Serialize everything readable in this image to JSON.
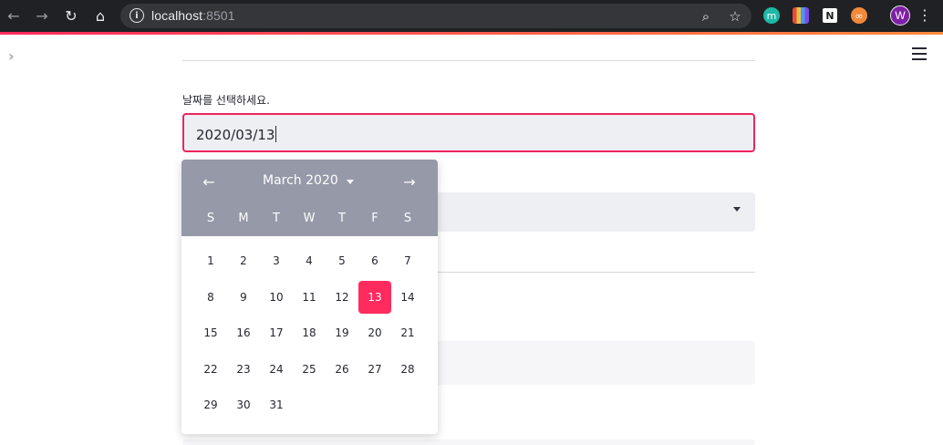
{
  "browser": {
    "url_host": "localhost",
    "url_port": ":8501",
    "profile_initial": "W",
    "extensions": [
      {
        "name": "m-extension-icon",
        "label": "m",
        "color": "#1fb8a6"
      },
      {
        "name": "palette-extension-icon",
        "label": "",
        "color": "#e9c341"
      },
      {
        "name": "notion-extension-icon",
        "label": "N",
        "color": "#ffffff"
      },
      {
        "name": "glasses-extension-icon",
        "label": "",
        "color": "#f08a3a"
      }
    ]
  },
  "page": {
    "date_label": "날짜를 선택하세요.",
    "date_value": "2020/03/13"
  },
  "calendar": {
    "month_label": "March 2020",
    "weekdays": [
      "S",
      "M",
      "T",
      "W",
      "T",
      "F",
      "S"
    ],
    "first_weekday_index": 0,
    "days_in_month": 31,
    "selected_day": 13
  }
}
